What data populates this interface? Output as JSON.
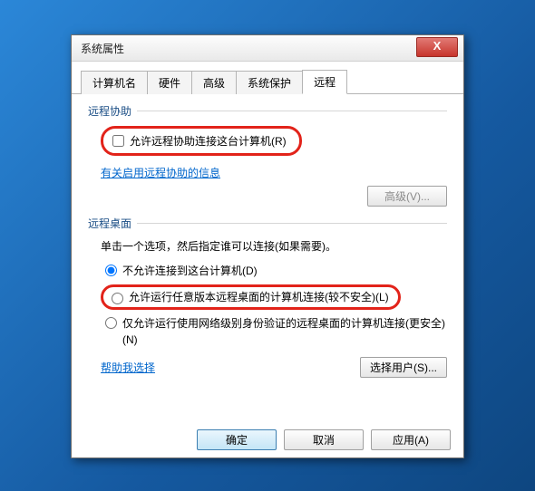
{
  "window": {
    "title": "系统属性",
    "close_glyph": "X"
  },
  "tabs": {
    "t0": "计算机名",
    "t1": "硬件",
    "t2": "高级",
    "t3": "系统保护",
    "t4": "远程"
  },
  "remote_assist": {
    "header": "远程协助",
    "checkbox_label": "允许远程协助连接这台计算机(R)",
    "help_link": "有关启用远程协助的信息",
    "advanced_btn": "高级(V)..."
  },
  "remote_desktop": {
    "header": "远程桌面",
    "desc": "单击一个选项，然后指定谁可以连接(如果需要)。",
    "opt0": "不允许连接到这台计算机(D)",
    "opt1": "允许运行任意版本远程桌面的计算机连接(较不安全)(L)",
    "opt2": "仅允许运行使用网络级别身份验证的远程桌面的计算机连接(更安全)(N)",
    "help_link": "帮助我选择",
    "select_users_btn": "选择用户(S)..."
  },
  "buttons": {
    "ok": "确定",
    "cancel": "取消",
    "apply": "应用(A)"
  }
}
